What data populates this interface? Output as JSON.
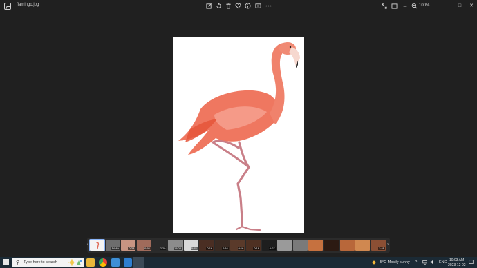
{
  "window": {
    "filename": "flamingo.jpg",
    "zoom": "100%"
  },
  "toolbar": {
    "icons": [
      "edit-image-icon",
      "rotate-icon",
      "delete-icon",
      "favorite-icon",
      "info-icon",
      "slideshow-icon",
      "more-icon"
    ]
  },
  "window_controls": {
    "minimize": "—",
    "maximize": "□",
    "close": "✕"
  },
  "photo": {
    "subject": "flamingo",
    "background": "#ffffff",
    "body_color": "#ef7760",
    "leg_color": "#c97f88",
    "beak_tip": "#1b1b1b"
  },
  "filmstrip": {
    "thumbnails": [
      {
        "color": "#f4f4f4",
        "duration": "",
        "selected": true
      },
      {
        "color": "#6d6d6d",
        "duration": "14:49"
      },
      {
        "color": "#c79482",
        "duration": "0:28"
      },
      {
        "color": "#a06b5b",
        "duration": "0:58"
      },
      {
        "color": "#2a2a2a",
        "duration": "2:20"
      },
      {
        "color": "#8c8c8c",
        "duration": "15:02"
      },
      {
        "color": "#d8d8d8",
        "duration": "5:15"
      },
      {
        "color": "#4a2e23",
        "duration": "0:16"
      },
      {
        "color": "#3a2a22",
        "duration": "0:16"
      },
      {
        "color": "#5a3a2a",
        "duration": "0:16"
      },
      {
        "color": "#4e3022",
        "duration": "0:16"
      },
      {
        "color": "#1e1e1e",
        "duration": "0:07"
      },
      {
        "color": "#9a9a9a",
        "duration": ""
      },
      {
        "color": "#7a7a7a",
        "duration": ""
      },
      {
        "color": "#c6713f",
        "duration": ""
      },
      {
        "color": "#2c1a12",
        "duration": ""
      },
      {
        "color": "#b8673a",
        "duration": ""
      },
      {
        "color": "#d08850",
        "duration": ""
      },
      {
        "color": "#8b4f34",
        "duration": "1:48"
      }
    ]
  },
  "taskbar": {
    "search_placeholder": "Type here to search",
    "apps": [
      {
        "name": "file-explorer",
        "color": "#e8b73a"
      },
      {
        "name": "chrome",
        "color": "#4a90d9"
      },
      {
        "name": "store",
        "color": "#3d8fd6"
      },
      {
        "name": "mail",
        "color": "#2f7fd1"
      },
      {
        "name": "photos",
        "color": "#5a9ee0"
      }
    ],
    "weather": "-5°C  Mostly sunny",
    "language": "ENG",
    "time": "10:03 AM",
    "date": "2023-12-02"
  }
}
